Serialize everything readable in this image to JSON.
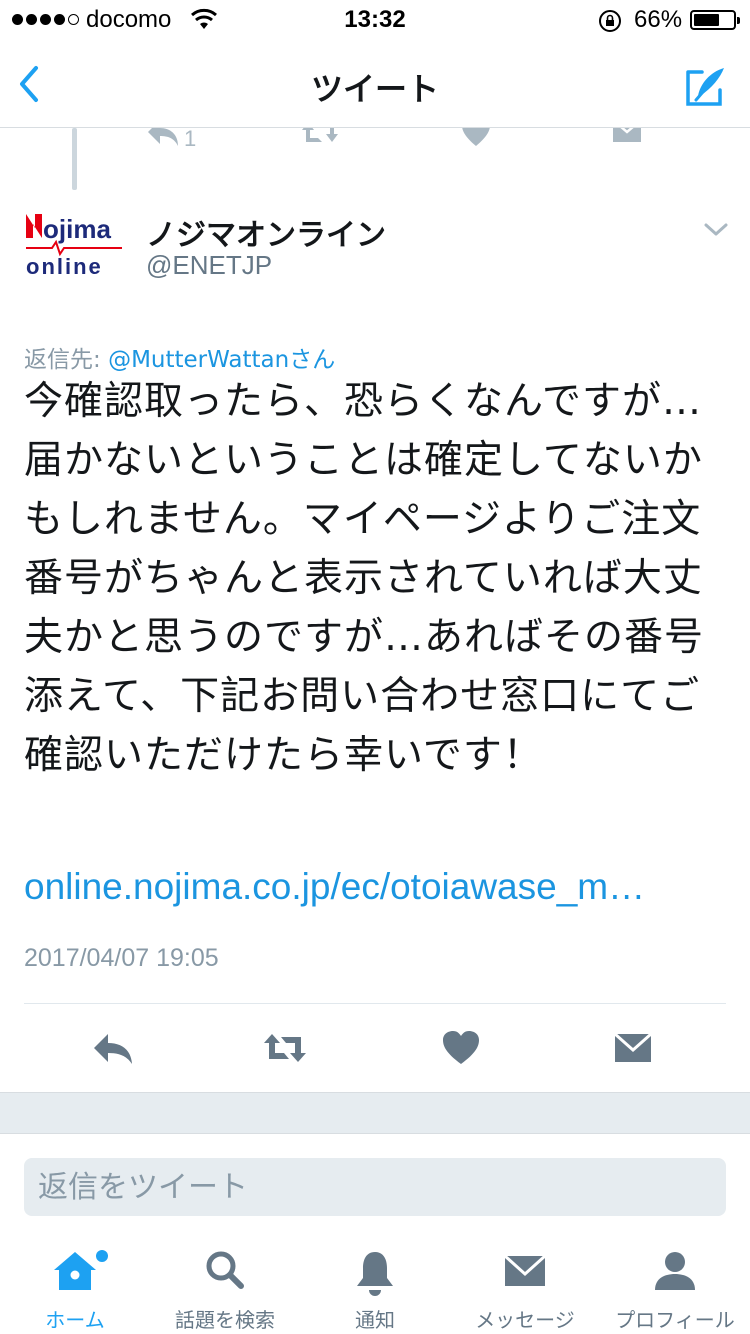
{
  "status_bar": {
    "carrier": "docomo",
    "time": "13:32",
    "battery_percent": "66%",
    "battery_level": 0.66,
    "signal_bars_filled": 4
  },
  "nav": {
    "title": "ツイート",
    "back_icon": "chevron-left-icon",
    "compose_icon": "compose-tweet-icon"
  },
  "previous_tweet": {
    "reply_count": "1"
  },
  "tweet": {
    "display_name": "ノジマオンライン",
    "handle": "@ENETJP",
    "avatar_logo_text": "Nojima online",
    "reply_prefix": "返信先: ",
    "reply_to": "@MutterWattanさん",
    "text": "今確認取ったら、恐らくなんですが…届かないということは確定してないかもしれません。マイページよりご注文番号がちゃんと表示されていれば大丈夫かと思うのですが…あればその番号添えて、下記お問い合わせ窓口にてご確認いただけたら幸いです！",
    "link": "online.nojima.co.jp/ec/otoiawase_m…",
    "timestamp": "2017/04/07 19:05"
  },
  "reply_box": {
    "placeholder": "返信をツイート"
  },
  "tabs": [
    {
      "label": "ホーム",
      "icon": "home-icon",
      "active": true
    },
    {
      "label": "話題を検索",
      "icon": "search-icon"
    },
    {
      "label": "通知",
      "icon": "bell-icon"
    },
    {
      "label": "メッセージ",
      "icon": "envelope-icon"
    },
    {
      "label": "プロフィール",
      "icon": "person-icon"
    }
  ],
  "colors": {
    "accent": "#1da1f2",
    "link": "#1b95e0",
    "icon_gray": "#aab8c2",
    "brand_red": "#e60012",
    "brand_navy": "#1d2a7a"
  }
}
